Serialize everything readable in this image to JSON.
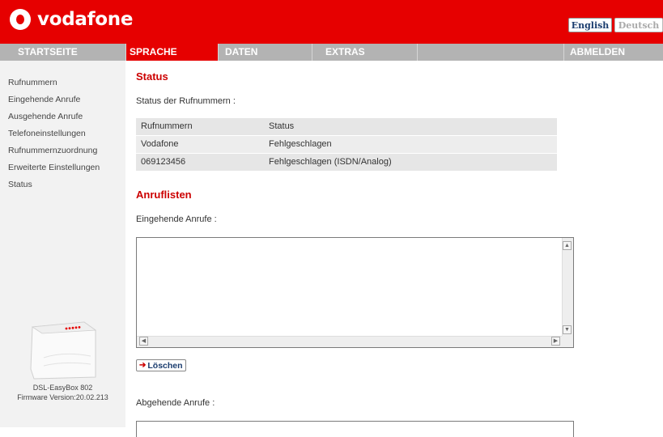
{
  "brand": {
    "name": "vodafone"
  },
  "languages": {
    "english": "English",
    "deutsch": "Deutsch"
  },
  "nav": {
    "startseite": "STARTSEITE",
    "sprache": "SPRACHE",
    "daten": "DATEN",
    "extras": "EXTRAS",
    "abmelden": "ABMELDEN"
  },
  "sidebar": {
    "items": [
      "Rufnummern",
      "Eingehende Anrufe",
      "Ausgehende Anrufe",
      "Telefoneinstellungen",
      "Rufnummernzuordnung",
      "Erweiterte Einstellungen",
      "Status"
    ],
    "device_name": "DSL-EasyBox 802",
    "firmware": "Firmware Version:20.02.213"
  },
  "status": {
    "heading": "Status",
    "subtitle": "Status der Rufnummern :",
    "columns": [
      "Rufnummern",
      "Status"
    ],
    "rows": [
      [
        "Vodafone",
        "Fehlgeschlagen"
      ],
      [
        "069123456",
        "Fehlgeschlagen (ISDN/Analog)"
      ]
    ]
  },
  "calllists": {
    "heading": "Anruflisten",
    "incoming_label": "Eingehende Anrufe :",
    "delete_button": "Löschen",
    "outgoing_label": "Abgehende Anrufe :"
  },
  "colors": {
    "brand_red": "#e60000",
    "nav_gray": "#b3b3b3",
    "sidebar_bg": "#f2f2f2"
  }
}
